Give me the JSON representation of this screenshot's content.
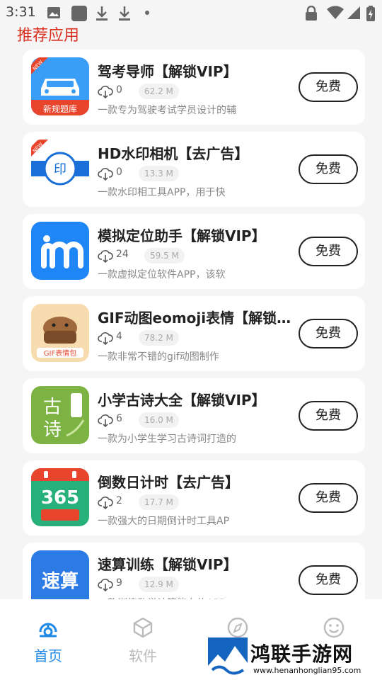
{
  "status_bar": {
    "time": "3:31"
  },
  "section_title": "推荐应用",
  "download_label_icon": "cloud-download-icon",
  "apps": [
    {
      "name": "驾考导师【解锁VIP】",
      "downloads": "0",
      "size": "62.2 M",
      "description": "一款专为驾驶考试学员设计的辅",
      "button": "免费",
      "icon": "car-icon",
      "icon_caption": "新规题库",
      "ribbon": "NEW",
      "tint": "#2f8ff0"
    },
    {
      "name": "HD水印相机【去广告】",
      "downloads": "0",
      "size": "13.3 M",
      "description": "一款水印相工具APP，用于快",
      "button": "免费",
      "icon": "stamp-icon",
      "icon_caption": "印",
      "ribbon": "NEW",
      "tint": "#1a6fd8"
    },
    {
      "name": "模拟定位助手【解锁VIP】",
      "downloads": "24",
      "size": "59.5 M",
      "description": "一款虚拟定位软件APP，该软",
      "button": "免费",
      "icon": "m-logo-icon",
      "icon_caption": "",
      "ribbon": "",
      "tint": "#1e86f5"
    },
    {
      "name": "GIF动图eomoji表情【解锁V...",
      "downloads": "4",
      "size": "78.2 M",
      "description": "一款非常不错的gif动图制作",
      "button": "免费",
      "icon": "capybara-icon",
      "icon_caption": "GIF表情包",
      "ribbon": "",
      "tint": "#f7d9a8"
    },
    {
      "name": "小学古诗大全【解锁VIP】",
      "downloads": "6",
      "size": "16.0 M",
      "description": "一款为小学生学习古诗词打造的",
      "button": "免费",
      "icon": "poem-icon",
      "icon_caption": "古诗",
      "ribbon": "",
      "tint": "#7cb342"
    },
    {
      "name": "倒数日计时【去广告】",
      "downloads": "2",
      "size": "17.7 M",
      "description": "一款强大的日期倒计时工具AP",
      "button": "免费",
      "icon": "calendar-icon",
      "icon_caption": "365",
      "ribbon": "",
      "tint": "#27b07a"
    },
    {
      "name": "速算训练【解锁VIP】",
      "downloads": "9",
      "size": "12.9 M",
      "description": "一款训练数学计算能力的APP",
      "button": "免费",
      "icon": "calc-icon",
      "icon_caption": "速算",
      "ribbon": "",
      "tint": "#2c7be5"
    }
  ],
  "bottom_nav": [
    {
      "label": "首页",
      "icon": "home-icon",
      "active": true
    },
    {
      "label": "软件",
      "icon": "cube-icon",
      "active": false
    },
    {
      "label": "",
      "icon": "compass-icon",
      "active": false
    },
    {
      "label": "",
      "icon": "smile-icon",
      "active": false
    }
  ],
  "watermark": {
    "title": "鸿联手游网",
    "url": "www.henanhonglian95.com"
  },
  "colors": {
    "accent": "#1e88e5",
    "section_title": "#d9301f",
    "inactive_nav": "#bbbbbb"
  }
}
